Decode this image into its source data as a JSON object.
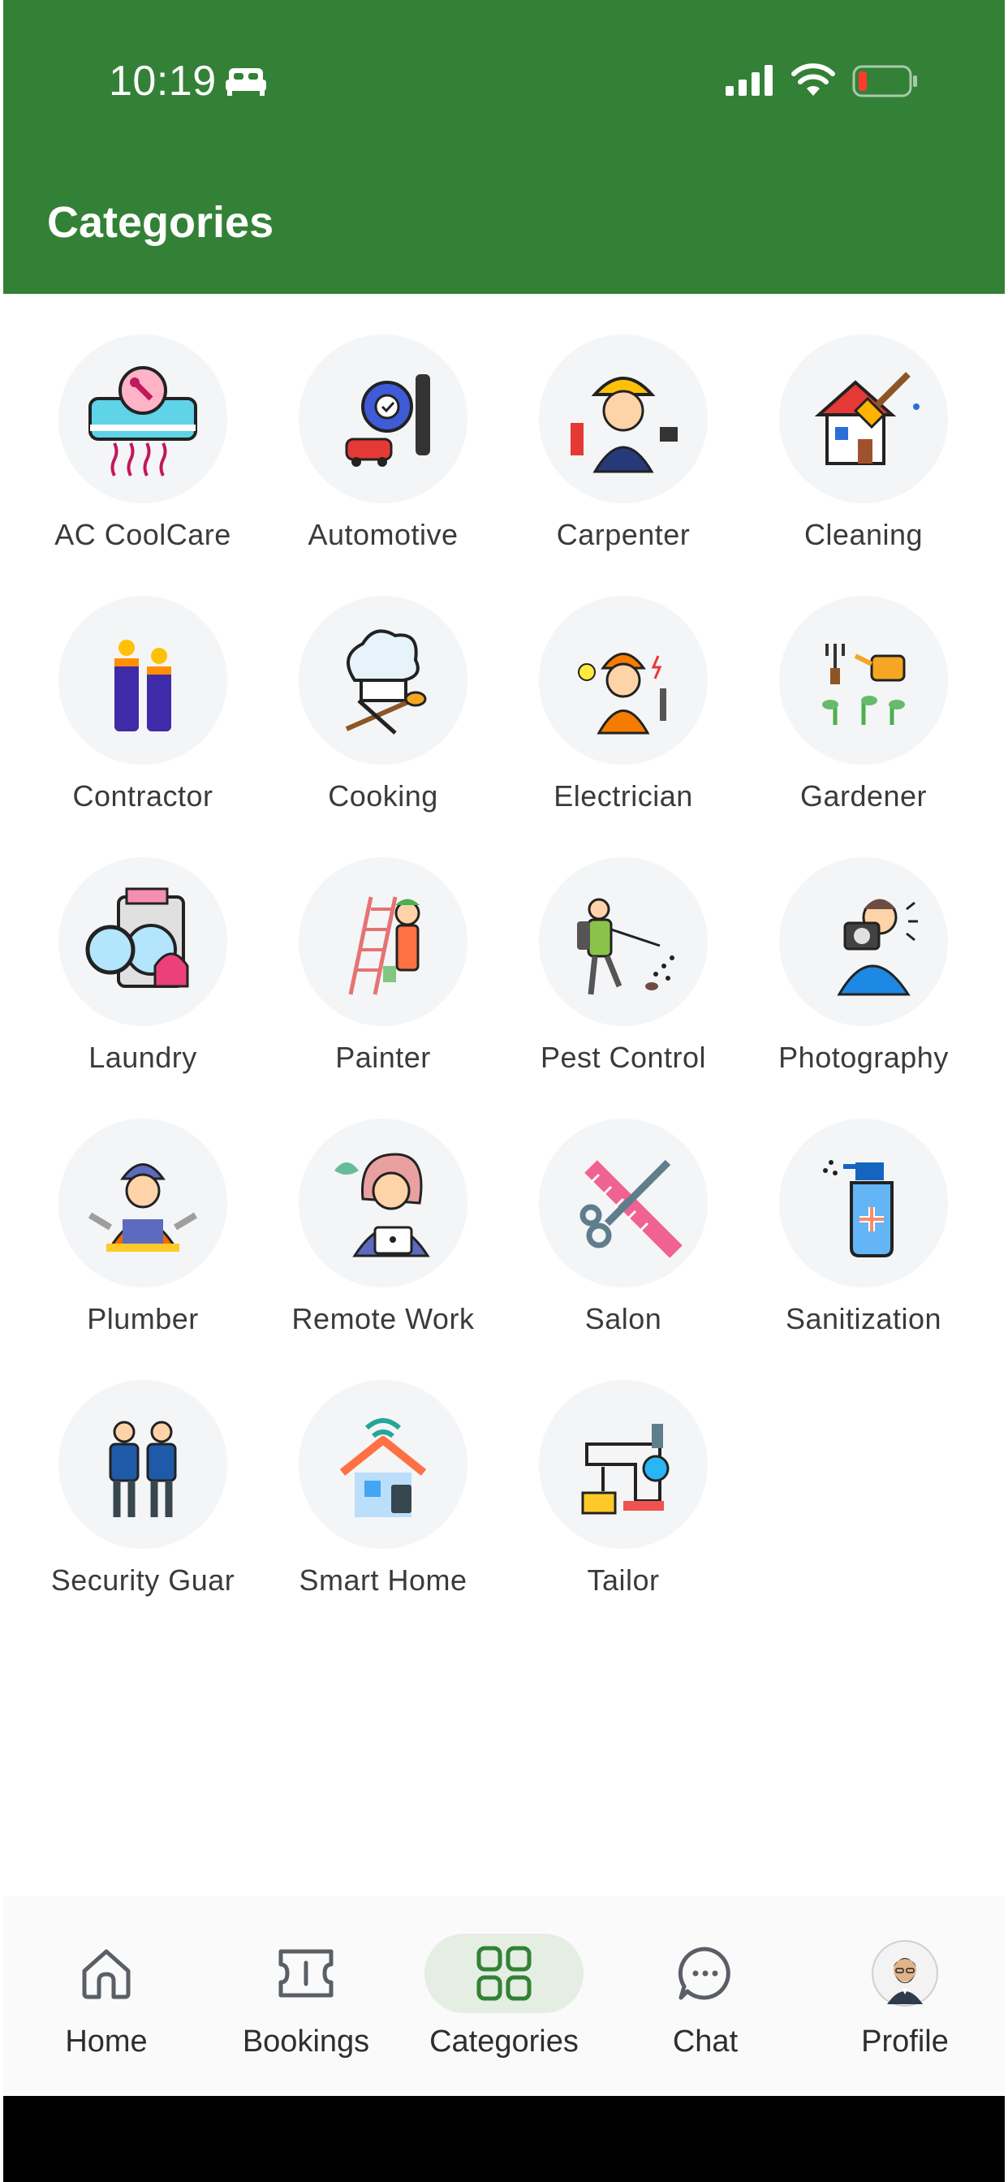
{
  "status_bar": {
    "time": "10:19",
    "icons": [
      "bed-icon",
      "cellular-signal-icon",
      "wifi-icon",
      "battery-low-icon"
    ]
  },
  "header": {
    "title": "Categories"
  },
  "categories": [
    {
      "label": "AC CoolCare",
      "icon": "air-conditioner-repair-icon"
    },
    {
      "label": "Automotive",
      "icon": "car-gear-icon"
    },
    {
      "label": "Carpenter",
      "icon": "carpenter-worker-icon"
    },
    {
      "label": "Cleaning",
      "icon": "house-broom-icon"
    },
    {
      "label": "Contractor",
      "icon": "construction-workers-icon"
    },
    {
      "label": "Cooking",
      "icon": "chef-hat-utensils-icon"
    },
    {
      "label": "Electrician",
      "icon": "electrician-worker-icon"
    },
    {
      "label": "Gardener",
      "icon": "watering-can-plants-icon"
    },
    {
      "label": "Laundry",
      "icon": "washing-machine-icon"
    },
    {
      "label": "Painter",
      "icon": "painter-ladder-icon"
    },
    {
      "label": "Pest Control",
      "icon": "pest-sprayer-icon"
    },
    {
      "label": "Photography",
      "icon": "photographer-camera-icon"
    },
    {
      "label": "Plumber",
      "icon": "plumber-worker-icon"
    },
    {
      "label": "Remote Work",
      "icon": "remote-worker-laptop-icon"
    },
    {
      "label": "Salon",
      "icon": "comb-scissors-icon"
    },
    {
      "label": "Sanitization",
      "icon": "spray-bottle-icon"
    },
    {
      "label": "Security Guar",
      "icon": "security-guards-icon"
    },
    {
      "label": "Smart Home",
      "icon": "smart-home-icon"
    },
    {
      "label": "Tailor",
      "icon": "sewing-machine-icon"
    }
  ],
  "bottom_nav": {
    "items": [
      {
        "label": "Home",
        "icon": "home-icon"
      },
      {
        "label": "Bookings",
        "icon": "ticket-icon"
      },
      {
        "label": "Categories",
        "icon": "grid-icon",
        "active": true
      },
      {
        "label": "Chat",
        "icon": "chat-bubble-icon"
      },
      {
        "label": "Profile",
        "icon": "avatar"
      }
    ]
  },
  "colors": {
    "header_bg": "#338136",
    "active_nav_bg": "#e4eee3",
    "active_nav_icon": "#338136",
    "category_circle_bg": "#f4f5f7"
  }
}
